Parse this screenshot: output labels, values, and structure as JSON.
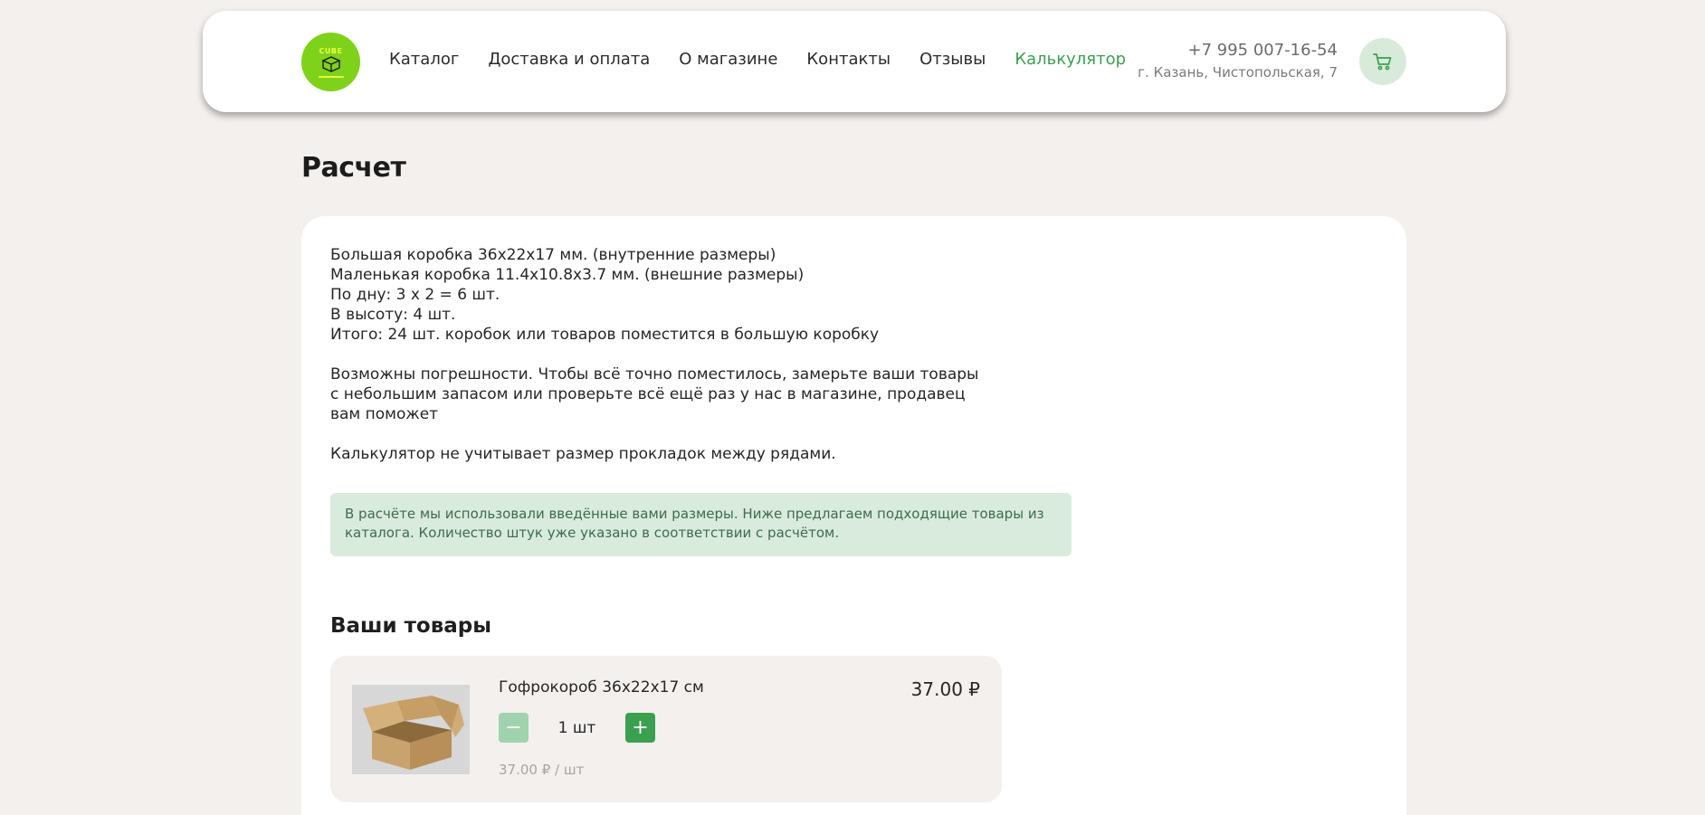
{
  "header": {
    "logo_text": "CUBE",
    "nav": [
      {
        "label": "Каталог",
        "active": false
      },
      {
        "label": "Доставка и оплата",
        "active": false
      },
      {
        "label": "О магазине",
        "active": false
      },
      {
        "label": "Контакты",
        "active": false
      },
      {
        "label": "Отзывы",
        "active": false
      },
      {
        "label": "Калькулятор",
        "active": true
      }
    ],
    "phone": "+7 995 007-16-54",
    "address": "г. Казань, Чистопольская, 7",
    "cart_icon": "cart-icon"
  },
  "page": {
    "title": "Расчет"
  },
  "calculation": {
    "lines": [
      "Большая коробка 36x22x17 мм. (внутренние размеры)",
      "Маленькая коробка 11.4x10.8x3.7 мм. (внешние размеры)",
      "По дну: 3 x 2 = 6 шт.",
      "В высоту: 4 шт.",
      "Итого: 24 шт. коробок или товаров поместится в большую коробку"
    ],
    "warning_lines": [
      "Возможны погрешности. Чтобы всё точно поместилось, замерьте ваши товары",
      "с небольшим запасом или проверьте всё ещё раз у нас в магазине, продавец",
      "вам поможет"
    ],
    "note": "Калькулятор не учитывает размер прокладок между рядами.",
    "notice_lines": [
      "В расчёте мы использовали введённые вами размеры. Ниже предлагаем подходящие товары из",
      "каталога. Количество штук уже указано в соответствии с расчётом."
    ]
  },
  "products": {
    "section_title": "Ваши товары",
    "items": [
      {
        "name": "Гофрокороб 36x22x17 см",
        "price": "37.00 ₽",
        "quantity": "1 шт",
        "unit_price": "37.00 ₽ / шт",
        "minus_label": "−",
        "plus_label": "+"
      }
    ]
  },
  "colors": {
    "accent": "#3aa04f",
    "logo": "#7fd21a",
    "background": "#f4f0ee",
    "notice_bg": "#d9ebdd"
  }
}
